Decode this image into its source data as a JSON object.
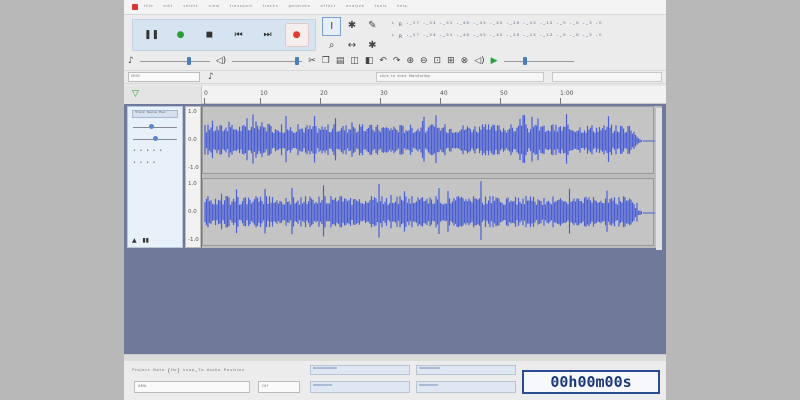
{
  "app": {
    "accent": "#4a5fd4",
    "wave_color": "#4a5fd4"
  },
  "menubar": {
    "items": [
      "ᴴⁱˡᵉ",
      "ᵉᵈⁱᵗ",
      "ˢᵉˡᵉᶜᵗ",
      "ᵛⁱᵉʷ",
      "ᵗʳᵃⁿˢᵖᵒʳᵗ",
      "ᵗʳᵃᶜᵏˢ",
      "ᵍᵉⁿᵉʳᵃᵗᵉ",
      "ᵉᶠᶠᵉᶜᵗ",
      "ᵃⁿᵃˡʸᶻᵉ",
      "ᵗᵒᵒˡˢ",
      "ʰᵉˡᵖ"
    ]
  },
  "transport": {
    "pause_icon": "pause-icon",
    "play_icon": "play-icon",
    "stop_icon": "stop-icon",
    "skip_start_icon": "skip-start-icon",
    "skip_end_icon": "skip-end-icon",
    "record_icon": "record-icon"
  },
  "tools": [
    "I",
    "✱",
    "✎",
    "⌕",
    "↔",
    "✱"
  ],
  "meters": {
    "record_meter_text": "ᴸ ʀ ·-⁵⁷ ·-⁵⁴ ·-⁵¹ ·-⁴⁸ ·-⁴⁵ ·-⁴² ·-¹⁸ ·-¹⁵ ·-¹² ·-⁹ ·-⁶ ·-³ ·⁰",
    "playback_meter_text": "ᴸ ʀ ·-⁵⁷ ·-⁵⁴ ·-⁵¹ ·-⁴⁸ ·-⁴⁵ ·-⁴² ·-¹⁸ ·-¹⁵ ·-¹² ·-⁹ ·-⁶ ·-³ ·⁰"
  },
  "row2": {
    "mic_volume": 0.72,
    "speaker_volume": 0.95,
    "playback_speed": 0.3
  },
  "devices": {
    "host": "ᴹᴹᴱ",
    "recording_channels": "ᶜˡⁱᶜᵏ ᵗᵒ ˢᵗᵃʳᵗ ᴹᵒⁿⁱᵗᵒʳⁱⁿᵍ"
  },
  "ruler": {
    "corner_icon": "▽",
    "ticks": [
      "0",
      "10",
      "20",
      "30",
      "40",
      "50",
      "1:00"
    ]
  },
  "track": {
    "name": "ᵀʳᵃᶜᵏ ᴺᵃᵐᵉ ᴿᵉᶜ",
    "scale_top": "1.0",
    "scale_mid": "0.0",
    "scale_bot": "-1.0",
    "scale_top2": "1.0",
    "scale_mid2": "0.0",
    "scale_bot2": "-1.0",
    "gain": 0.4,
    "pan": 0.5
  },
  "selection": {
    "labels": "ᴾʳᵒʲᵉᶜᵗ ᴿᵃᵗᵉ (ᴴᶻ)   ˢⁿᵃᵖ-ᵀᵒ   ᴬᵘᵈⁱᵒ ᴾᵒˢⁱᵗⁱᵒⁿ",
    "project_rate": "ᴬᴹᴬ",
    "snap_to": "ᴼᶠᶠ",
    "pos_1": "ᴵᴺᴵᴵᴵᴵᴵᴵᴵᴵᴵᴵᴵᴵᴵᴵᴵᴵᴵᴵᴵᴵ",
    "pos_2": "ᴵᴵᴵᴵᴵᴵᴵᴵᴵᴵᴵᴵᴵᴵᴵᴵᴵᴵᴵᴵᴵ",
    "sel_1": "ᴵᴵᴵᴵᴵᴵᴵᴵᴵᴵᴵᴵᴵᴵᴵᴵᴵᴵᴵ",
    "sel_2": "ᴵᴵᴵᴵᴵᴵᴵᴵᴵᴵᴵᴵᴵᴵᴵᴵᴵᴵᴵ",
    "time_display": "00h00m00s"
  }
}
